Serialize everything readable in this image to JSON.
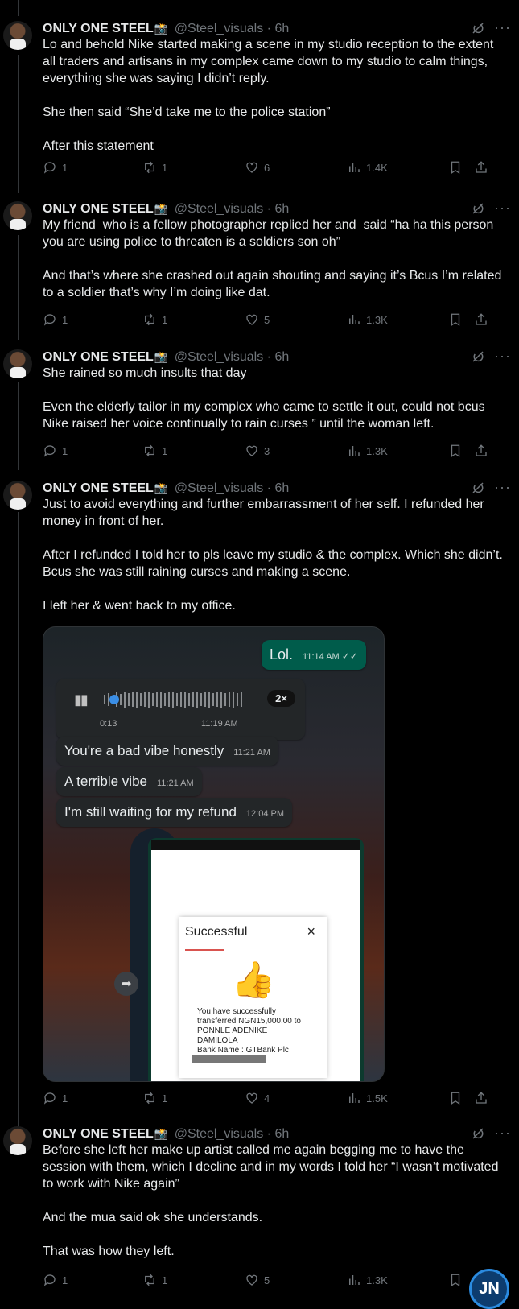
{
  "author": {
    "name": "ONLY ONE STEEL",
    "name_emoji": "📸",
    "handle": "@Steel_visuals",
    "time": "· 6h"
  },
  "tweets": [
    {
      "text": "Lo and behold Nike started making a scene in my studio reception to the extent all traders and artisans in my complex came down to my studio to calm things, everything she was saying I didn’t reply.\n\nShe then said “She’d take me to the police station”\n\nAfter this statement",
      "replies": "1",
      "reposts": "1",
      "likes": "6",
      "views": "1.4K"
    },
    {
      "text": "My friend  who is a fellow photographer replied her and  said “ha ha this person you are using police to threaten is a soldiers son oh”\n\nAnd that’s where she crashed out again shouting and saying it’s Bcus I’m related to a soldier that’s why I’m doing like dat.",
      "replies": "1",
      "reposts": "1",
      "likes": "5",
      "views": "1.3K"
    },
    {
      "text": "She rained so much insults that day\n\nEven the elderly tailor in my complex who came to settle it out, could not bcus Nike raised her voice continually to rain curses ” until the woman left.",
      "replies": "1",
      "reposts": "1",
      "likes": "3",
      "views": "1.3K"
    },
    {
      "text": "Just to avoid everything and further embarrassment of her self. I refunded her money in front of her.\n\nAfter I refunded I told her to pls leave my studio & the complex. Which she didn’t. Bcus she was still raining curses and making a scene.\n\nI left her & went back to my office.",
      "replies": "1",
      "reposts": "1",
      "likes": "4",
      "views": "1.5K"
    },
    {
      "text": "Before she left her make up artist called me again begging me to have the session with them, which I decline and in my words I told her “I wasn’t motivated to work with Nike again”\n\nAnd the mua said ok she understands.\n\nThat was how they left.",
      "replies": "1",
      "reposts": "1",
      "likes": "5",
      "views": "1.3K"
    }
  ],
  "chat_screenshot": {
    "sent": {
      "text": "Lol.",
      "time": "11:14 AM"
    },
    "voice_note": {
      "duration": "0:13",
      "time": "11:19 AM",
      "speed": "2×"
    },
    "received": [
      {
        "text": "You're a bad vibe honestly",
        "time": "11:21 AM"
      },
      {
        "text": "A terrible vibe",
        "time": "11:21 AM"
      },
      {
        "text": "I'm still waiting for my refund",
        "time": "12:04 PM"
      }
    ],
    "receipt": {
      "title": "Successful",
      "close": "×",
      "line1": "You have successfully",
      "line2": "transferred NGN15,000.00 to",
      "line3": "PONNLE ADENIKE",
      "line4": "DAMILOLA",
      "line5": "Bank Name : GTBank Plc"
    }
  },
  "watermark": {
    "text": "JN"
  },
  "colors": {
    "background": "#000000",
    "text": "#e7e9ea",
    "muted": "#71767b",
    "thread_line": "#333639",
    "whatsapp_sent": "#005c4b",
    "accent_red": "#d9534f"
  }
}
